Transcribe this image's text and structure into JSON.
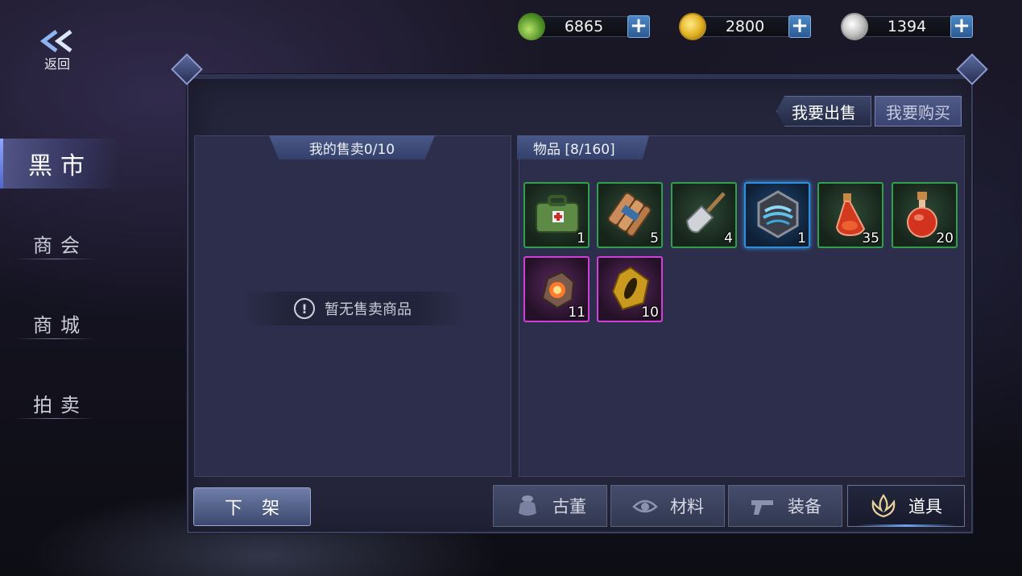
{
  "header": {
    "back_label": "返回",
    "currencies": [
      {
        "name": "jade-currency",
        "amount": "6865",
        "plus": "+"
      },
      {
        "name": "gold-currency",
        "amount": "2800",
        "plus": "+"
      },
      {
        "name": "silver-currency",
        "amount": "1394",
        "plus": "+"
      }
    ]
  },
  "sidebar": {
    "items": [
      {
        "label": "黑市",
        "active": true
      },
      {
        "label": "商会",
        "active": false
      },
      {
        "label": "商城",
        "active": false
      },
      {
        "label": "拍卖",
        "active": false
      }
    ]
  },
  "tabs": {
    "sell": "我要出售",
    "buy": "我要购买"
  },
  "my_sales": {
    "header": "我的售卖0/10",
    "empty_text": "暂无售卖商品",
    "warn_glyph": "!"
  },
  "inventory": {
    "header": "物品  [8/160]",
    "items": [
      {
        "icon": "medical-kit-icon",
        "count": "1",
        "rarity": "green"
      },
      {
        "icon": "explosive-bundle-icon",
        "count": "5",
        "rarity": "green"
      },
      {
        "icon": "shovel-icon",
        "count": "4",
        "rarity": "green"
      },
      {
        "icon": "wind-rune-icon",
        "count": "1",
        "rarity": "blue"
      },
      {
        "icon": "red-potion-small-icon",
        "count": "35",
        "rarity": "green"
      },
      {
        "icon": "red-potion-large-icon",
        "count": "20",
        "rarity": "green"
      },
      {
        "icon": "fire-ore-icon",
        "count": "11",
        "rarity": "purple"
      },
      {
        "icon": "golden-gem-icon",
        "count": "10",
        "rarity": "purple"
      }
    ]
  },
  "bottom": {
    "unlist_label": "下架",
    "categories": [
      {
        "label": "古董",
        "icon": "antique-vase-icon",
        "active": false
      },
      {
        "label": "材料",
        "icon": "material-eye-icon",
        "active": false
      },
      {
        "label": "装备",
        "icon": "pistol-icon",
        "active": false
      },
      {
        "label": "道具",
        "icon": "flame-lotus-icon",
        "active": true
      }
    ]
  },
  "colors": {
    "rarity_green": "#30a14a",
    "rarity_blue": "#2f8fdc",
    "rarity_purple": "#d03fd6",
    "accent_blue": "#4b88c6"
  }
}
